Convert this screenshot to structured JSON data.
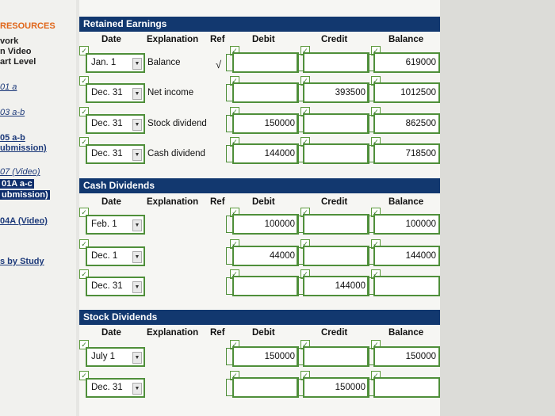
{
  "sidebar": {
    "items": [
      {
        "text": "RESOURCES"
      },
      {
        "text": "vork"
      },
      {
        "text": "n Video"
      },
      {
        "text": "art Level"
      },
      {
        "text": "01 a"
      },
      {
        "text": "03 a-b"
      },
      {
        "text": "05 a-b"
      },
      {
        "text": "ubmission)"
      },
      {
        "text": "07 (Video)"
      },
      {
        "text": "01A a-c"
      },
      {
        "text": "ubmission)"
      },
      {
        "text": "04A (Video)"
      },
      {
        "text": "s by Study"
      }
    ]
  },
  "headers": {
    "date": "Date",
    "explanation": "Explanation",
    "ref": "Ref",
    "debit": "Debit",
    "credit": "Credit",
    "balance": "Balance"
  },
  "sections": [
    {
      "title": "Retained Earnings",
      "rows": [
        {
          "date": "Jan. 1",
          "explanation": "Balance",
          "ref": "√",
          "debit": "",
          "credit": "",
          "balance": "619000"
        },
        {
          "date": "Dec. 31",
          "explanation": "Net income",
          "ref": "",
          "debit": "",
          "credit": "393500",
          "balance": "1012500"
        },
        {
          "date": "Dec. 31",
          "explanation": "Stock dividend",
          "ref": "",
          "debit": "150000",
          "credit": "",
          "balance": "862500"
        },
        {
          "date": "Dec. 31",
          "explanation": "Cash dividend",
          "ref": "",
          "debit": "144000",
          "credit": "",
          "balance": "718500"
        }
      ]
    },
    {
      "title": "Cash Dividends",
      "rows": [
        {
          "date": "Feb. 1",
          "explanation": "",
          "ref": "",
          "debit": "100000",
          "credit": "",
          "balance": "100000"
        },
        {
          "date": "Dec. 1",
          "explanation": "",
          "ref": "",
          "debit": "44000",
          "credit": "",
          "balance": "144000"
        },
        {
          "date": "Dec. 31",
          "explanation": "",
          "ref": "",
          "debit": "",
          "credit": "144000",
          "balance": ""
        }
      ]
    },
    {
      "title": "Stock Dividends",
      "rows": [
        {
          "date": "July 1",
          "explanation": "",
          "ref": "",
          "debit": "150000",
          "credit": "",
          "balance": "150000"
        },
        {
          "date": "Dec. 31",
          "explanation": "",
          "ref": "",
          "debit": "",
          "credit": "150000",
          "balance": ""
        }
      ]
    }
  ],
  "icons": {
    "check": "checkbox-check-icon",
    "dropdown": "dropdown-arrow-icon"
  },
  "colors": {
    "header_bar": "#12386f",
    "field_border": "#4f8f3a",
    "sidebar_heading": "#e0661a",
    "link": "#1d3a7a"
  }
}
